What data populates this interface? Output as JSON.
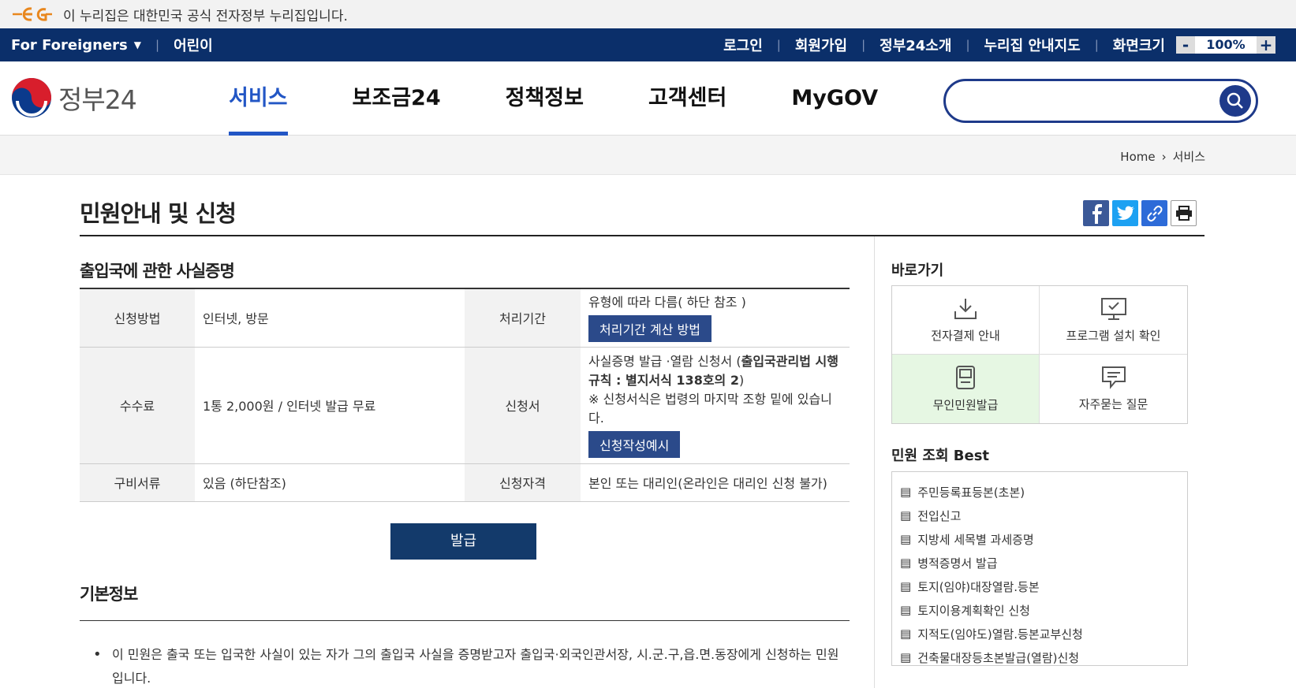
{
  "gov_banner": {
    "text": "이 누리집은 대한민국 공식 전자정부 누리집입니다."
  },
  "util": {
    "foreigners": "For Foreigners",
    "kids": "어린이",
    "links": [
      "로그인",
      "회원가입",
      "정부24소개",
      "누리집 안내지도",
      "화면크기"
    ],
    "zoom_minus": "-",
    "zoom_value": "100%",
    "zoom_plus": "+"
  },
  "header": {
    "logo_text": "정부24",
    "nav": [
      "서비스",
      "보조금24",
      "정책정보",
      "고객센터",
      "MyGOV"
    ],
    "active_nav": "서비스",
    "search_placeholder": ""
  },
  "breadcrumb": {
    "home": "Home",
    "current": "서비스"
  },
  "page": {
    "title": "민원안내 및 신청"
  },
  "service": {
    "title": "출입국에 관한 사실증명",
    "rows": {
      "method_label": "신청방법",
      "method_value": "인터넷, 방문",
      "period_label": "처리기간",
      "period_value": "유형에 따라 다름( 하단 참조 )",
      "period_button": "처리기간 계산 방법",
      "fee_label": "수수료",
      "fee_value": "1통 2,000원 / 인터넷 발급 무료",
      "form_label": "신청서",
      "form_value_1": "사실증명 발급 ·열람 신청서 (",
      "form_value_bold": "출입국관리법 시행규칙 : 별지서식 138호의 2",
      "form_value_2": ")",
      "form_note": "※ 신청서식은 법령의 마지막 조항 밑에 있습니다.",
      "form_button": "신청작성예시",
      "docs_label": "구비서류",
      "docs_value": "있음 (하단참조)",
      "elig_label": "신청자격",
      "elig_value": "본인 또는 대리인(온라인은 대리인 신청 불가)"
    },
    "issue_button": "발급"
  },
  "basic": {
    "title": "기본정보",
    "line1": "이 민원은 출국 또는 입국한 사실이 있는 자가 그의 출입국 사실을 증명받고자 출입국·외국인관서장, 시.군.구,읍.면.동장에게 신청하는 민원",
    "line2": "입니다."
  },
  "sidebar": {
    "quick_title": "바로가기",
    "quick": [
      {
        "label": "전자결제 안내",
        "icon": "download-icon"
      },
      {
        "label": "프로그램 설치 확인",
        "icon": "monitor-check-icon"
      },
      {
        "label": "무인민원발급",
        "icon": "kiosk-icon"
      },
      {
        "label": "자주묻는 질문",
        "icon": "speech-bubble-icon"
      }
    ],
    "best_title": "민원 조회 Best",
    "best": [
      "주민등록표등본(초본)",
      "전입신고",
      "지방세 세목별 과세증명",
      "병적증명서 발급",
      "토지(임야)대장열람.등본",
      "토지이용계획확인 신청",
      "지적도(임야도)열람.등본교부신청",
      "건축물대장등초본발급(열람)신청"
    ]
  },
  "colors": {
    "navy": "#0b2f6a",
    "accent": "#2256c5",
    "button": "#133a6b",
    "highlight": "#e6f7e3"
  }
}
